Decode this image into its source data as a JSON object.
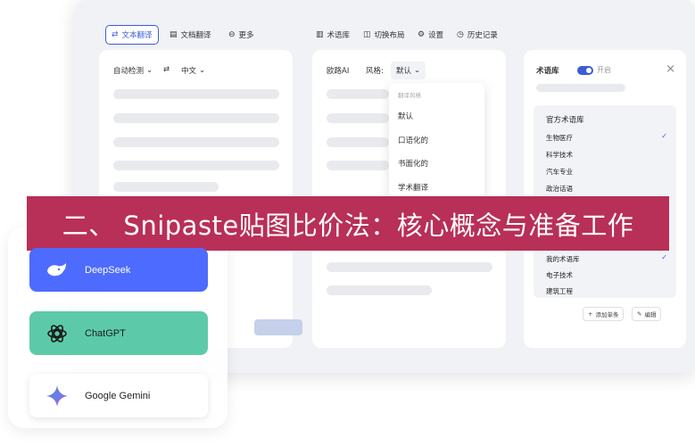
{
  "toolbar": {
    "items": [
      {
        "label": "文本翻译",
        "icon": "translate-icon",
        "glyph": "⇄"
      },
      {
        "label": "文档翻译",
        "icon": "document-icon",
        "glyph": "▤"
      },
      {
        "label": "更多",
        "icon": "more-icon",
        "glyph": "⊖"
      },
      {
        "label": "术语库",
        "icon": "book-icon",
        "glyph": "▥"
      },
      {
        "label": "切换布局",
        "icon": "layout-icon",
        "glyph": "◫"
      },
      {
        "label": "设置",
        "icon": "settings-icon",
        "glyph": "⚙"
      },
      {
        "label": "历史记录",
        "icon": "history-icon",
        "glyph": "◷"
      }
    ]
  },
  "source": {
    "lang_from": "自动检测",
    "swap_glyph": "⇄",
    "lang_to": "中文",
    "chevron": "⌄"
  },
  "target": {
    "engine": "欧路AI",
    "style_label": "风格:",
    "style_value": "默认",
    "chevron": "⌄"
  },
  "dropdown": {
    "header": "翻译风格",
    "options": [
      "默认",
      "口语化的",
      "书面化的",
      "学术翻译"
    ]
  },
  "glossary": {
    "title": "术语库",
    "toggle_label": "开启",
    "toggle_on": true,
    "close_glyph": "×",
    "list_title": "官方术语库",
    "items": [
      "生物医疗",
      "科学技术",
      "汽车专业",
      "政治话语"
    ],
    "checked_glyph": "✓",
    "my_items": [
      "我的术语库",
      "电子技术",
      "建筑工程"
    ],
    "add_label": "添加单条",
    "add_glyph": "+",
    "edit_label": "编辑",
    "edit_glyph": "✎"
  },
  "banner": {
    "text": "二、 Snipaste贴图比价法：核心概念与准备工作"
  },
  "ai_cards": [
    {
      "label": "DeepSeek",
      "icon": "whale-icon"
    },
    {
      "label": "ChatGPT",
      "icon": "openai-icon"
    },
    {
      "label": "Google Gemini",
      "icon": "sparkle-icon"
    }
  ],
  "colors": {
    "accent": "#3c5dd4",
    "banner": "#b82f57",
    "deepseek": "#4d6bfe",
    "chatgpt": "#5ccaa8"
  }
}
